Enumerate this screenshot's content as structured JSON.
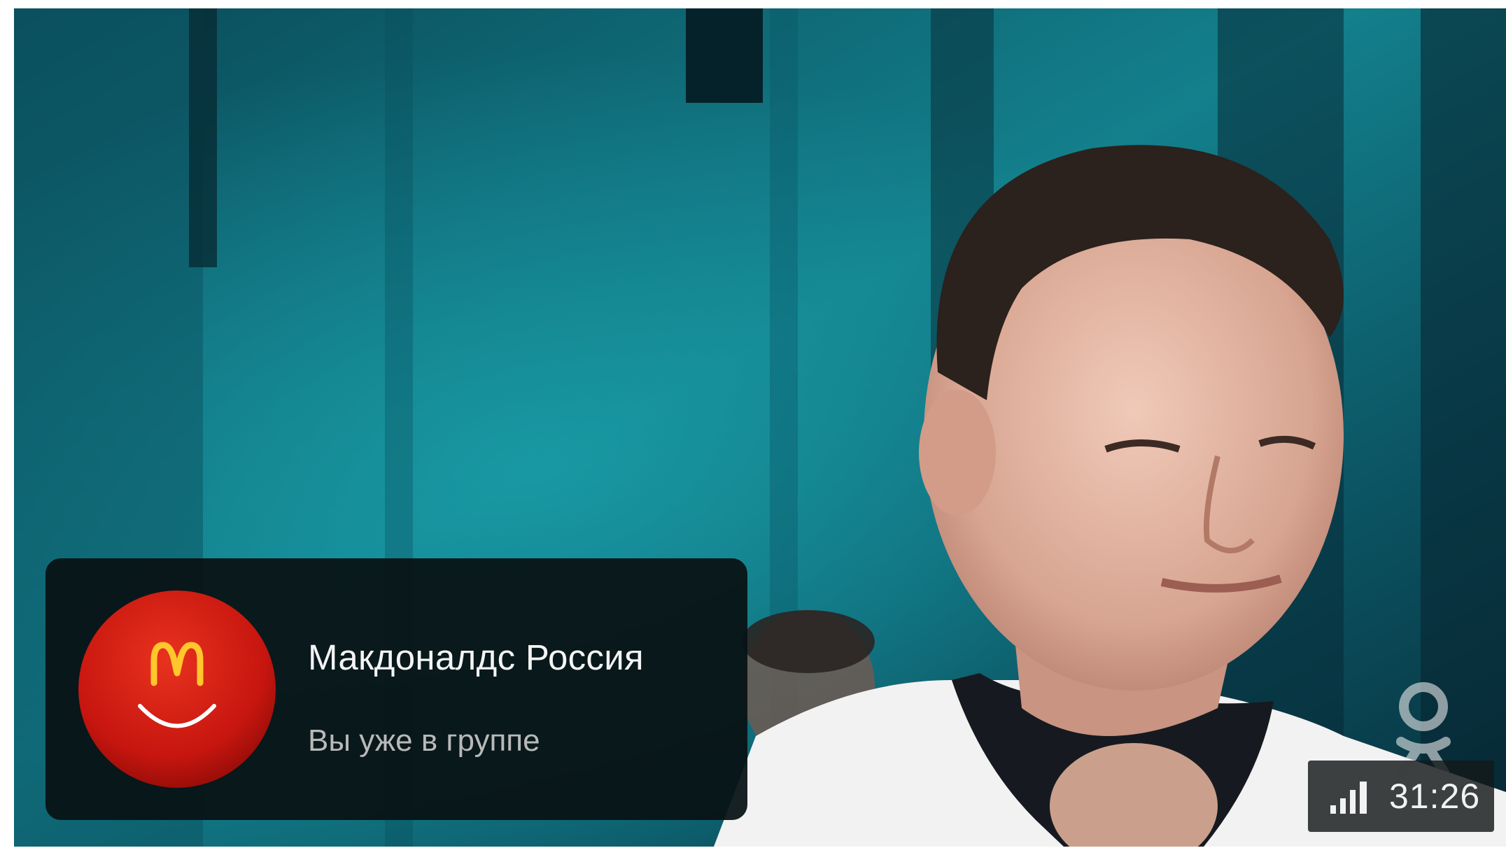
{
  "player": {
    "background_icon": "video-frame"
  },
  "group_card": {
    "avatar_icon": "mcdonalds-logo",
    "name": "Макдоналдс Россия",
    "status": "Вы уже в группе",
    "brand_red": "#d8201b",
    "brand_yellow": "#ffc72c"
  },
  "overlay": {
    "watermark_icon": "ok-logo-icon",
    "quality_icon": "signal-bars-icon",
    "duration": "31:26"
  }
}
